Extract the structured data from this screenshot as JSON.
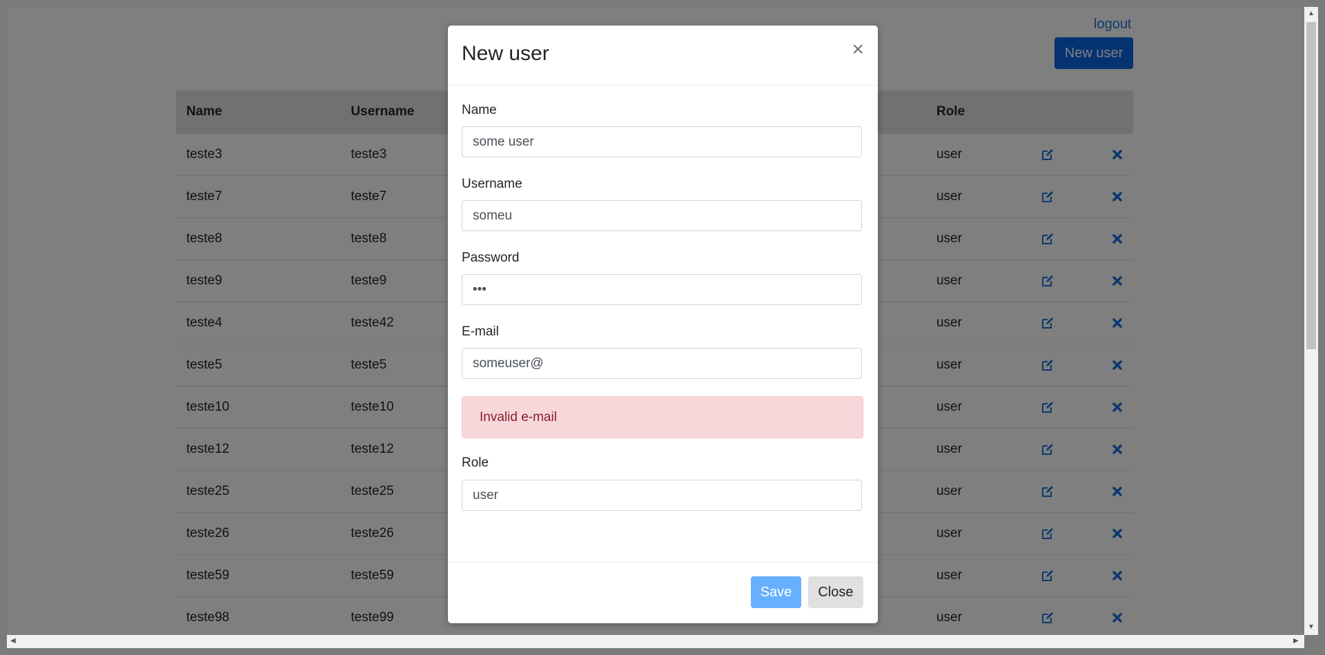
{
  "header": {
    "logout_label": "logout",
    "new_user_label": "New user"
  },
  "table": {
    "headers": {
      "name": "Name",
      "username": "Username",
      "email": "",
      "role": "Role"
    },
    "rows": [
      {
        "name": "teste3",
        "username": "teste3",
        "role": "user"
      },
      {
        "name": "teste7",
        "username": "teste7",
        "role": "user"
      },
      {
        "name": "teste8",
        "username": "teste8",
        "role": "user"
      },
      {
        "name": "teste9",
        "username": "teste9",
        "role": "user"
      },
      {
        "name": "teste4",
        "username": "teste42",
        "role": "user"
      },
      {
        "name": "teste5",
        "username": "teste5",
        "role": "user"
      },
      {
        "name": "teste10",
        "username": "teste10",
        "role": "user"
      },
      {
        "name": "teste12",
        "username": "teste12",
        "role": "user"
      },
      {
        "name": "teste25",
        "username": "teste25",
        "role": "user"
      },
      {
        "name": "teste26",
        "username": "teste26",
        "role": "user"
      },
      {
        "name": "teste59",
        "username": "teste59",
        "role": "user"
      },
      {
        "name": "teste98",
        "username": "teste99",
        "role": "user"
      }
    ]
  },
  "modal": {
    "title": "New user",
    "close_glyph": "×",
    "fields": {
      "name": {
        "label": "Name",
        "value": "some user"
      },
      "username": {
        "label": "Username",
        "value": "someu"
      },
      "password": {
        "label": "Password",
        "value": "•••"
      },
      "email": {
        "label": "E-mail",
        "value": "someuser@"
      },
      "role": {
        "label": "Role",
        "value": "user"
      }
    },
    "error": "Invalid e-mail",
    "save_label": "Save",
    "close_label": "Close"
  },
  "icons": {
    "edit": "edit-icon",
    "delete": "delete-icon"
  },
  "colors": {
    "primary": "#0b66e4",
    "save_disabled": "#66b0ff",
    "alert_bg": "#f8d7da",
    "alert_text": "#842029"
  }
}
